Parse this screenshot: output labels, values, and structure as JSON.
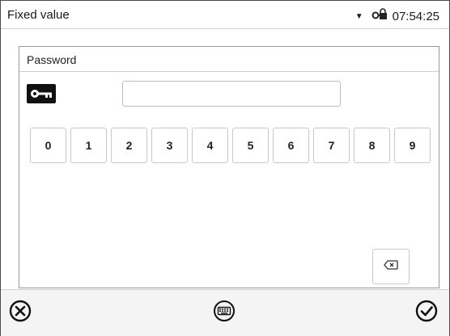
{
  "statusbar": {
    "title": "Fixed value",
    "time": "07:54:25",
    "icons": [
      "dropdown-caret-icon",
      "lock-key-icon"
    ]
  },
  "dialog": {
    "title": "Password",
    "key_icon": "key-icon",
    "password_value": "",
    "digits": [
      "0",
      "1",
      "2",
      "3",
      "4",
      "5",
      "6",
      "7",
      "8",
      "9"
    ],
    "backspace_icon": "backspace-icon"
  },
  "toolbar": {
    "cancel_icon": "cancel-circle-icon",
    "keyboard_icon": "keyboard-icon",
    "confirm_icon": "confirm-check-icon"
  }
}
